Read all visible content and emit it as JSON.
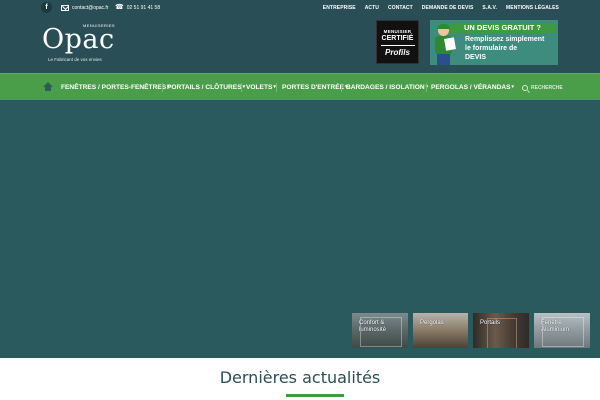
{
  "topbar": {
    "facebook_icon_text": "f",
    "email": "contact@opac.fr",
    "phone": "02 51 91 41 58",
    "links": [
      "ENTREPRISE",
      "ACTU",
      "CONTACT",
      "DEMANDE DE DEVIS",
      "S.A.V.",
      "MENTIONS LÉGALES"
    ]
  },
  "header": {
    "logo": {
      "supertitle": "MENUISERIES",
      "name": "Opac",
      "tagline": "Le Fabricant de vos envies"
    },
    "certification": {
      "line1": "MENUISIER",
      "line2": "CERTIFIÉ",
      "brand": "Profils"
    },
    "devis_banner": {
      "title": "UN DEVIS GRATUIT ?",
      "line1": "Remplissez simplement",
      "line2": "le formulaire de",
      "line3": "DEVIS"
    }
  },
  "nav": {
    "items": [
      {
        "label": "FENÊTRES / PORTES-FENÊTRES"
      },
      {
        "label": "PORTAILS / CLÔTURES"
      },
      {
        "label": "VOLETS"
      },
      {
        "label": "PORTES D'ENTRÉE"
      },
      {
        "label": "BARDAGES / ISOLATION"
      },
      {
        "label": "PERGOLAS / VÉRANDAS"
      }
    ],
    "search_label": "RECHERCHE"
  },
  "hero": {
    "thumbnails": [
      {
        "label": "Confort &\nluminosité"
      },
      {
        "label": "Pergolas"
      },
      {
        "label": "Portails"
      },
      {
        "label": "Fenêtre\nAluminium"
      }
    ]
  },
  "section": {
    "title": "Dernières actualités"
  },
  "colors": {
    "header_bg": "#2a4e55",
    "nav_bg": "#4b9e49",
    "hero_bg": "#2a5a5d",
    "accent_green": "#3e9a3e"
  }
}
